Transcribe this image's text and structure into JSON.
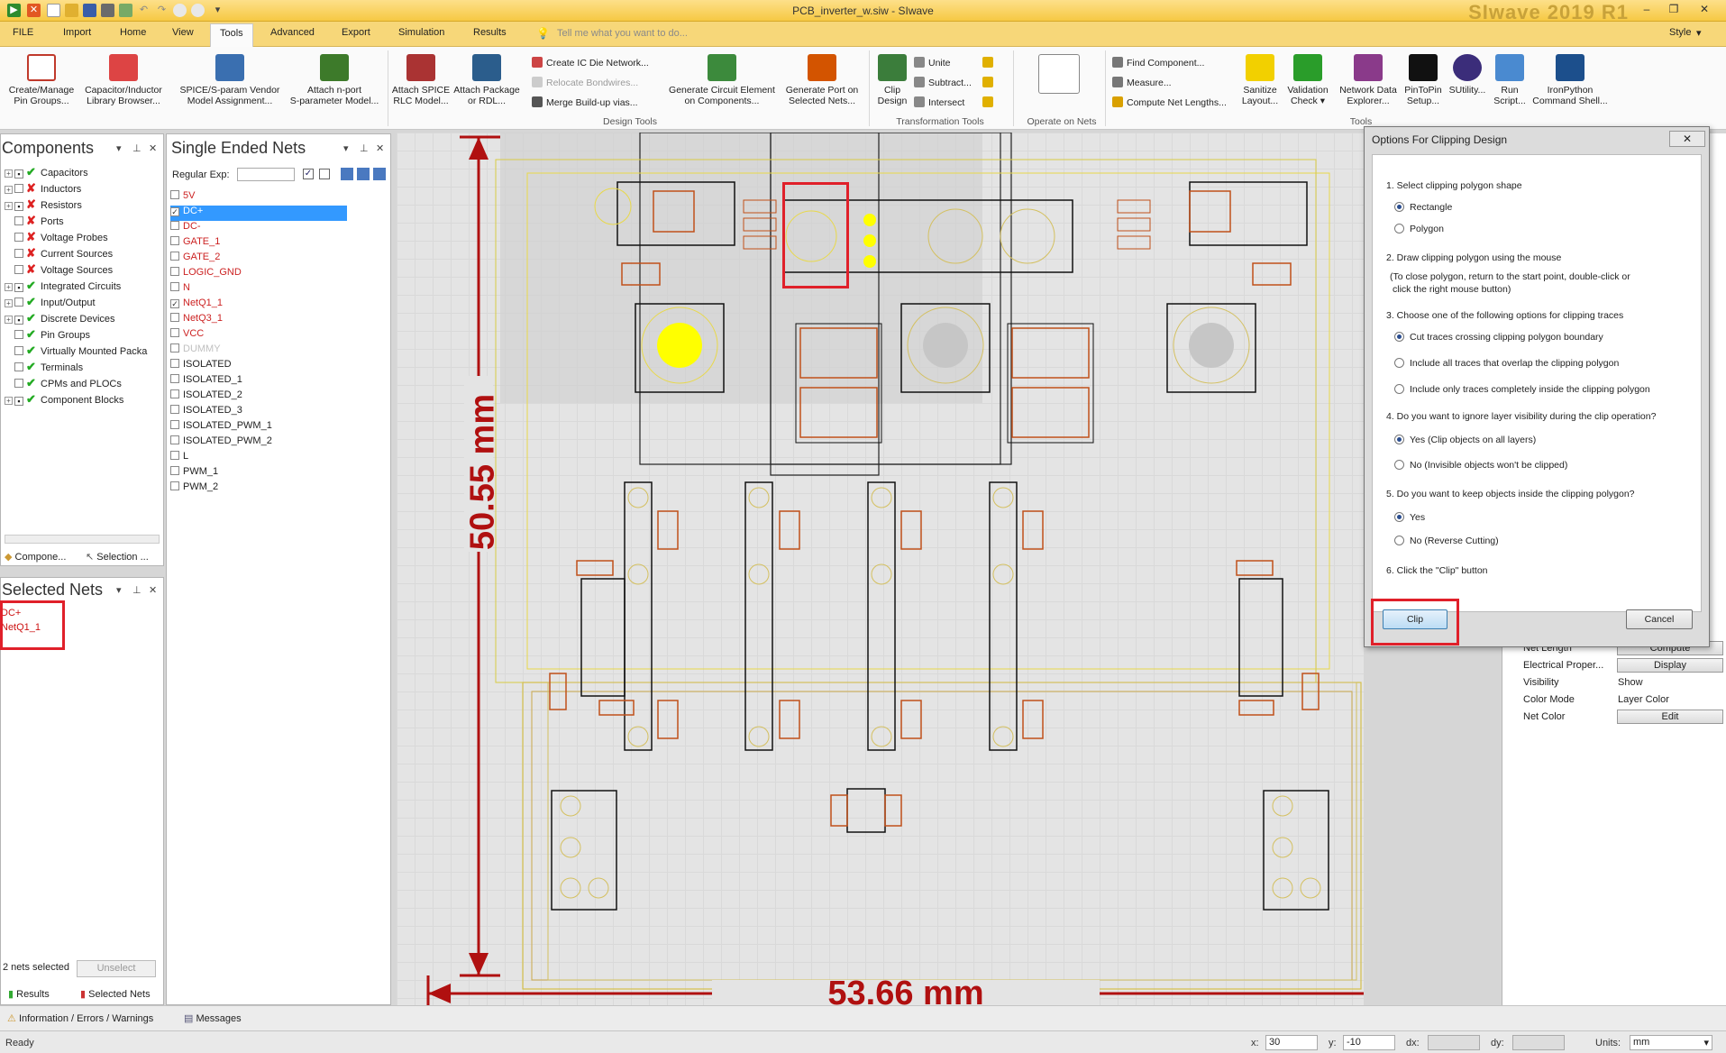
{
  "window": {
    "doc_title": "PCB_inverter_w.siw - SIwave",
    "brand": "SIwave 2019 R1",
    "style_label": "Style"
  },
  "menu": {
    "tabs": [
      "FILE",
      "Import",
      "Home",
      "View",
      "Tools",
      "Advanced",
      "Export",
      "Simulation",
      "Results"
    ],
    "active": "Tools",
    "tell_me": "Tell me what you want to do..."
  },
  "ribbon": {
    "create_manage": "Create/Manage\nPin Groups...",
    "cap_ind": "Capacitor/Inductor\nLibrary Browser...",
    "spice_vendor": "SPICE/S-param Vendor\nModel Assignment...",
    "attach_nport": "Attach n-port\nS-parameter Model...",
    "attach_spice": "Attach SPICE\nRLC Model...",
    "attach_pkg": "Attach Package\nor RDL...",
    "create_ic": "Create IC Die Network...",
    "relocate": "Relocate Bondwires...",
    "merge": "Merge Build-up vias...",
    "gen_circuit": "Generate Circuit Element\non Components...",
    "gen_port": "Generate Port on\nSelected Nets...",
    "design_tools": "Design Tools",
    "clip": "Clip\nDesign",
    "unite": "Unite",
    "subtract": "Subtract...",
    "intersect": "Intersect",
    "transformation_tools": "Transformation Tools",
    "operate_on_nets": "Operate on Nets",
    "find_component": "Find Component...",
    "measure": "Measure...",
    "compute_net": "Compute Net Lengths...",
    "sanitize": "Sanitize\nLayout...",
    "validation": "Validation\nCheck ▾",
    "network_data": "Network Data\nExplorer...",
    "pintopin": "PinToPin\nSetup...",
    "sutility": "SUtility...",
    "run_script": "Run\nScript...",
    "ironpython": "IronPython\nCommand Shell...",
    "tools": "Tools"
  },
  "components_panel": {
    "title": "Components",
    "items": [
      {
        "label": "Capacitors",
        "status": "ok",
        "expand": true,
        "checked": true
      },
      {
        "label": "Inductors",
        "status": "x",
        "expand": true,
        "checked": false
      },
      {
        "label": "Resistors",
        "status": "x",
        "expand": true,
        "checked": true
      },
      {
        "label": "Ports",
        "status": "x",
        "expand": false,
        "checked": false
      },
      {
        "label": "Voltage Probes",
        "status": "x",
        "expand": false,
        "checked": false
      },
      {
        "label": "Current Sources",
        "status": "x",
        "expand": false,
        "checked": false
      },
      {
        "label": "Voltage Sources",
        "status": "x",
        "expand": false,
        "checked": false
      },
      {
        "label": "Integrated Circuits",
        "status": "ok",
        "expand": true,
        "checked": true
      },
      {
        "label": "Input/Output",
        "status": "ok",
        "expand": true,
        "checked": false
      },
      {
        "label": "Discrete Devices",
        "status": "ok",
        "expand": true,
        "checked": true
      },
      {
        "label": "Pin Groups",
        "status": "ok",
        "expand": false,
        "checked": false
      },
      {
        "label": "Virtually Mounted Packa",
        "status": "ok",
        "expand": false,
        "checked": false
      },
      {
        "label": "Terminals",
        "status": "ok",
        "expand": false,
        "checked": false
      },
      {
        "label": "CPMs and PLOCs",
        "status": "ok",
        "expand": false,
        "checked": false
      },
      {
        "label": "Component Blocks",
        "status": "ok",
        "expand": true,
        "checked": true
      }
    ],
    "tab_components": "Compone...",
    "tab_selection": "Selection ..."
  },
  "nets_panel": {
    "title": "Single Ended Nets",
    "regex_label": "Regular Exp:",
    "nets": [
      {
        "name": "5V",
        "color": "#cc2222",
        "checked": false
      },
      {
        "name": "DC+",
        "color": "#ffffff",
        "checked": true,
        "selected": true
      },
      {
        "name": "DC-",
        "color": "#cc2222",
        "checked": false
      },
      {
        "name": "GATE_1",
        "color": "#cc2222",
        "checked": false
      },
      {
        "name": "GATE_2",
        "color": "#cc2222",
        "checked": false
      },
      {
        "name": "LOGIC_GND",
        "color": "#cc2222",
        "checked": false
      },
      {
        "name": "N",
        "color": "#cc2222",
        "checked": false
      },
      {
        "name": "NetQ1_1",
        "color": "#cc2222",
        "checked": true
      },
      {
        "name": "NetQ3_1",
        "color": "#cc2222",
        "checked": false
      },
      {
        "name": "VCC",
        "color": "#cc2222",
        "checked": false
      },
      {
        "name": "DUMMY",
        "color": "#c0c0c0",
        "checked": false
      },
      {
        "name": "ISOLATED",
        "color": "#222222",
        "checked": false
      },
      {
        "name": "ISOLATED_1",
        "color": "#222222",
        "checked": false
      },
      {
        "name": "ISOLATED_2",
        "color": "#222222",
        "checked": false
      },
      {
        "name": "ISOLATED_3",
        "color": "#222222",
        "checked": false
      },
      {
        "name": "ISOLATED_PWM_1",
        "color": "#222222",
        "checked": false
      },
      {
        "name": "ISOLATED_PWM_2",
        "color": "#222222",
        "checked": false
      },
      {
        "name": "L",
        "color": "#222222",
        "checked": false
      },
      {
        "name": "PWM_1",
        "color": "#222222",
        "checked": false
      },
      {
        "name": "PWM_2",
        "color": "#222222",
        "checked": false
      }
    ]
  },
  "selected_nets_panel": {
    "title": "Selected Nets",
    "items": [
      "DC+",
      "NetQ1_1"
    ],
    "count_text": "2 nets selected",
    "unselect": "Unselect",
    "tab_results": "Results",
    "tab_selected": "Selected Nets"
  },
  "canvas": {
    "dim_vertical": "50.55 mm",
    "dim_horizontal": "53.66 mm"
  },
  "dialog": {
    "title": "Options For Clipping Design",
    "step1": "1. Select clipping polygon shape",
    "opt_rectangle": "Rectangle",
    "opt_polygon": "Polygon",
    "step2": "2. Draw clipping polygon using the mouse",
    "step2_note1": "(To close polygon, return to the start point, double-click or",
    "step2_note2": "click the right mouse button)",
    "step3": "3. Choose one of the following options for clipping traces",
    "opt_cut": "Cut traces crossing clipping polygon boundary",
    "opt_include_all": "Include all traces that overlap the clipping polygon",
    "opt_include_only": "Include only traces completely inside the clipping polygon",
    "step4": "4. Do you want to ignore layer visibility during the clip operation?",
    "opt_yes_clip": "Yes (Clip objects on all layers)",
    "opt_no_invisible": "No (Invisible objects won't be clipped)",
    "step5": "5. Do you want to keep objects inside the clipping polygon?",
    "opt_yes": "Yes",
    "opt_no_reverse": "No (Reverse Cutting)",
    "step6": "6. Click the \"Clip\" button",
    "clip_button": "Clip",
    "cancel_button": "Cancel"
  },
  "properties": {
    "net_length_key": "Net Length",
    "net_length_btn": "Compute",
    "elec_key": "Electrical Proper...",
    "elec_btn": "Display",
    "visibility_key": "Visibility",
    "visibility_val": "Show",
    "color_mode_key": "Color Mode",
    "color_mode_val": "Layer Color",
    "net_color_key": "Net Color",
    "net_color_btn": "Edit"
  },
  "bottom_tabs": {
    "info": "Information / Errors / Warnings",
    "messages": "Messages"
  },
  "status": {
    "ready": "Ready",
    "x_label": "x:",
    "x_val": "30",
    "y_label": "y:",
    "y_val": "-10",
    "dx_label": "dx:",
    "dy_label": "dy:",
    "units_label": "Units:",
    "units_val": "mm"
  }
}
